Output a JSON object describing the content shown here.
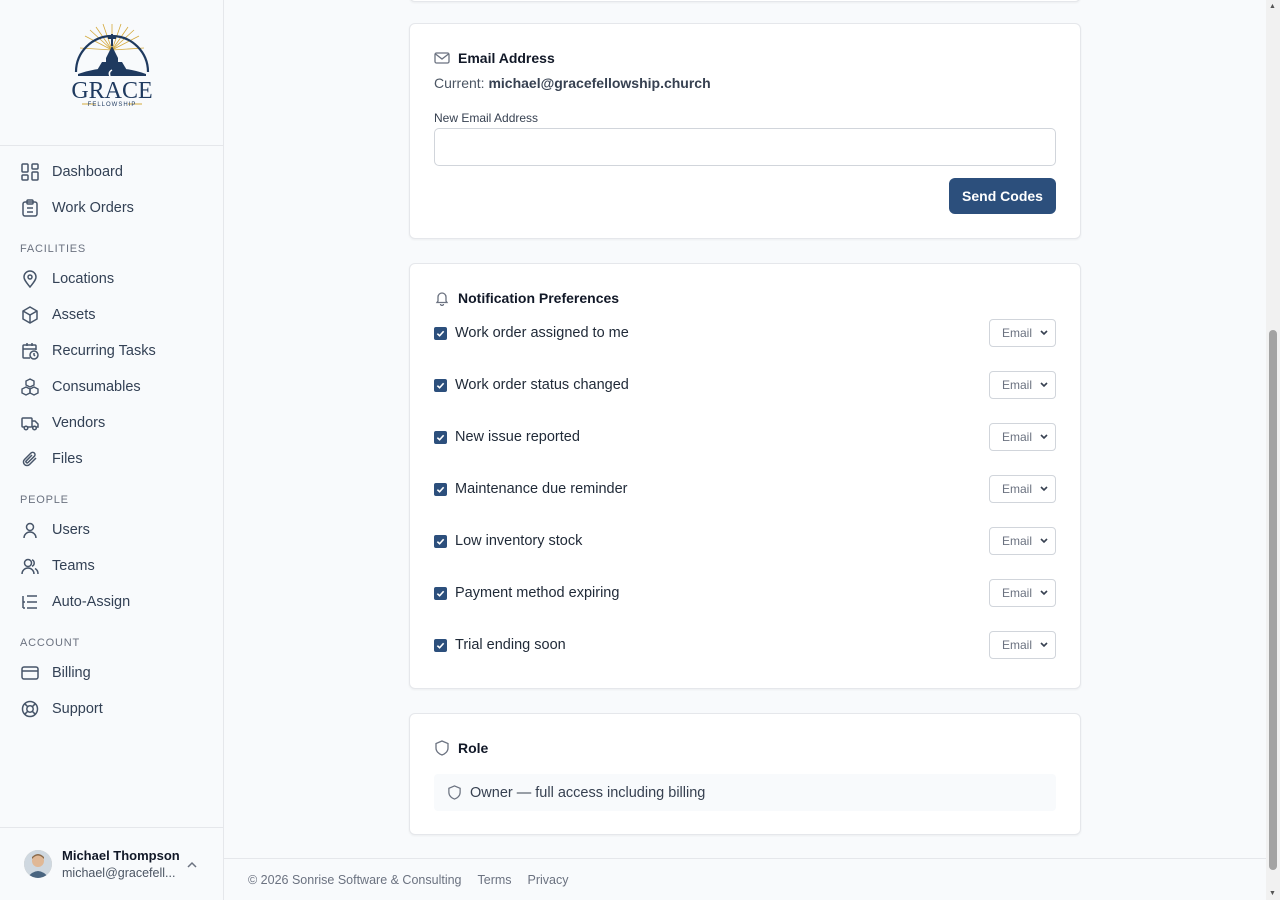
{
  "app": {
    "logo_text": "GRACE",
    "logo_subtext": "FELLOWSHIP"
  },
  "sidebar": {
    "items": [
      {
        "label": "Dashboard",
        "icon": "dashboard-icon"
      },
      {
        "label": "Work Orders",
        "icon": "clipboard-icon"
      }
    ],
    "sections": [
      {
        "title": "FACILITIES",
        "items": [
          {
            "label": "Locations",
            "icon": "map-pin-icon"
          },
          {
            "label": "Assets",
            "icon": "box-icon"
          },
          {
            "label": "Recurring Tasks",
            "icon": "calendar-clock-icon"
          },
          {
            "label": "Consumables",
            "icon": "boxes-icon"
          },
          {
            "label": "Vendors",
            "icon": "truck-icon"
          },
          {
            "label": "Files",
            "icon": "paperclip-icon"
          }
        ]
      },
      {
        "title": "PEOPLE",
        "items": [
          {
            "label": "Users",
            "icon": "user-icon"
          },
          {
            "label": "Teams",
            "icon": "users-icon"
          },
          {
            "label": "Auto-Assign",
            "icon": "list-icon"
          }
        ]
      },
      {
        "title": "ACCOUNT",
        "items": [
          {
            "label": "Billing",
            "icon": "credit-card-icon"
          },
          {
            "label": "Support",
            "icon": "lifebuoy-icon"
          }
        ]
      }
    ],
    "user": {
      "name": "Michael Thompson",
      "email": "michael@gracefell..."
    }
  },
  "email_card": {
    "title": "Email Address",
    "current_label": "Current:",
    "current_value": "michael@gracefellowship.church",
    "new_label": "New Email Address",
    "new_value": "",
    "button": "Send Codes"
  },
  "notifications": {
    "title": "Notification Preferences",
    "rows": [
      {
        "label": "Work order assigned to me",
        "checked": true,
        "channel": "Email"
      },
      {
        "label": "Work order status changed",
        "checked": true,
        "channel": "Email"
      },
      {
        "label": "New issue reported",
        "checked": true,
        "channel": "Email"
      },
      {
        "label": "Maintenance due reminder",
        "checked": true,
        "channel": "Email"
      },
      {
        "label": "Low inventory stock",
        "checked": true,
        "channel": "Email"
      },
      {
        "label": "Payment method expiring",
        "checked": true,
        "channel": "Email"
      },
      {
        "label": "Trial ending soon",
        "checked": true,
        "channel": "Email"
      }
    ]
  },
  "role": {
    "title": "Role",
    "value": "Owner — full access including billing"
  },
  "footer": {
    "copyright": "© 2026 Sonrise Software & Consulting",
    "terms": "Terms",
    "privacy": "Privacy"
  },
  "colors": {
    "accent": "#2c4f7c",
    "logo_navy": "#1f3a5f",
    "logo_gold": "#d4a93c"
  }
}
